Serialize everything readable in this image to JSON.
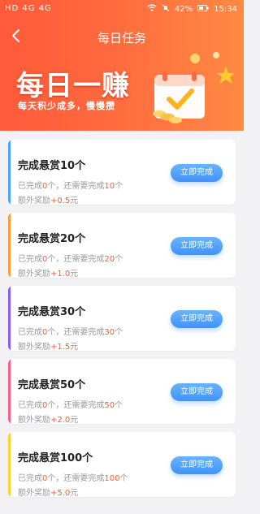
{
  "status_bar": {
    "left": "HD 4G 4G",
    "battery": "42%",
    "time": "15:34"
  },
  "header": {
    "title": "每日任务",
    "hero_title": "每日一赚",
    "hero_subtitle": "每天积少成多，慢慢攒"
  },
  "tasks": [
    {
      "title": "完成悬赏10个",
      "done_prefix": "已完成",
      "done_count": "0",
      "need_mid": "个，还需要完成",
      "need_count": "10",
      "need_suffix": "个",
      "bonus_prefix": "额外奖励",
      "bonus": "+0.5",
      "bonus_suffix": "元",
      "button": "立即完成",
      "accent": "#4aa3ff"
    },
    {
      "title": "完成悬赏20个",
      "done_prefix": "已完成",
      "done_count": "0",
      "need_mid": "个，还需要完成",
      "need_count": "20",
      "need_suffix": "个",
      "bonus_prefix": "额外奖励",
      "bonus": "+1.0",
      "bonus_suffix": "元",
      "button": "立即完成",
      "accent": "#ff9b3a"
    },
    {
      "title": "完成悬赏30个",
      "done_prefix": "已完成",
      "done_count": "0",
      "need_mid": "个，还需要完成",
      "need_count": "30",
      "need_suffix": "个",
      "bonus_prefix": "额外奖励",
      "bonus": "+1.5",
      "bonus_suffix": "元",
      "button": "立即完成",
      "accent": "#8a5cff"
    },
    {
      "title": "完成悬赏50个",
      "done_prefix": "已完成",
      "done_count": "0",
      "need_mid": "个，还需要完成",
      "need_count": "50",
      "need_suffix": "个",
      "bonus_prefix": "额外奖励",
      "bonus": "+2.0",
      "bonus_suffix": "元",
      "button": "立即完成",
      "accent": "#ff5d86"
    },
    {
      "title": "完成悬赏100个",
      "done_prefix": "已完成",
      "done_count": "0",
      "need_mid": "个，还需要完成",
      "need_count": "100",
      "need_suffix": "个",
      "bonus_prefix": "额外奖励",
      "bonus": "+5.0",
      "bonus_suffix": "元",
      "button": "立即完成",
      "accent": "#ffd12a"
    }
  ],
  "icons": {
    "back": "chevron-left-icon",
    "wifi": "wifi-icon",
    "mute": "bell-off-icon",
    "battery": "battery-icon",
    "calendar": "calendar-check-icon"
  },
  "colors": {
    "hero_gradient_start": "#ff5a3a",
    "hero_gradient_end": "#ff8a43",
    "button_blue": "#3f93f8",
    "reward_red": "#ff5a3a"
  }
}
